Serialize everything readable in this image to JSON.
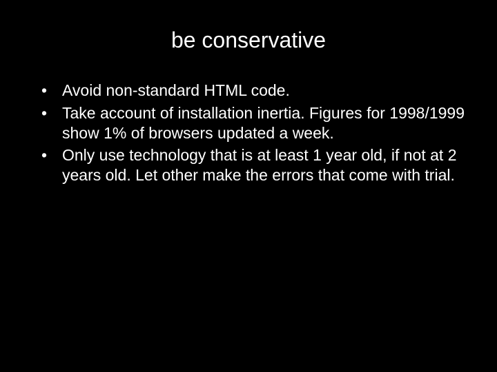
{
  "slide": {
    "title": "be conservative",
    "bullets": [
      "Avoid non-standard HTML code.",
      "Take account of installation inertia. Figures for 1998/1999 show 1% of browsers updated a week.",
      "Only use technology that is at least 1 year old, if not at 2 years old. Let other make the errors that come with trial."
    ]
  }
}
